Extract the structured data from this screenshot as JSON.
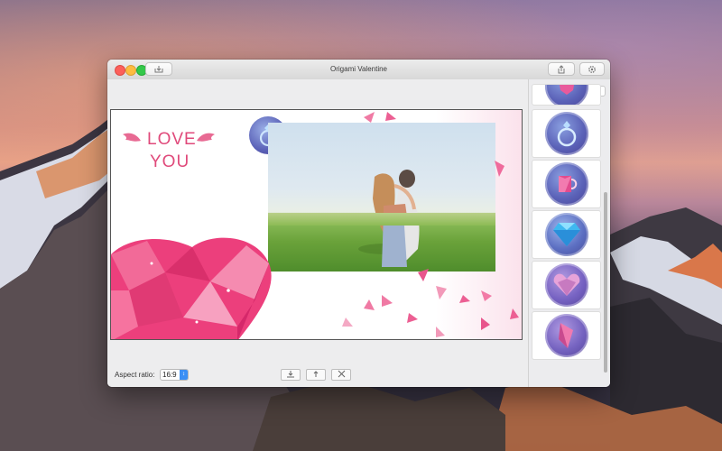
{
  "window": {
    "title": "Origami Valentine"
  },
  "toolbar": {
    "left_button_icon": "import-icon",
    "share_icon": "share-icon",
    "settings_icon": "gear-icon"
  },
  "canvas": {
    "line1": "LOVE",
    "line2": "YOU"
  },
  "bottom_bar": {
    "aspect_label": "Aspect ratio:",
    "aspect_value": "16:9",
    "buttons": [
      "download-icon",
      "upload-icon",
      "close-icon"
    ]
  },
  "sidebar": {
    "tabs": [
      "sticker-tab-icon",
      "shape-tab-icon"
    ],
    "items": [
      "origami-heart-partial",
      "ring-badge",
      "mug-badge",
      "diamond-badge",
      "heart-gem-badge",
      "origami-crane-badge"
    ]
  },
  "colors": {
    "accent_pink": "#e04a7b",
    "badge_purple": "#5b62b8",
    "select_blue": "#3b8ff5"
  }
}
